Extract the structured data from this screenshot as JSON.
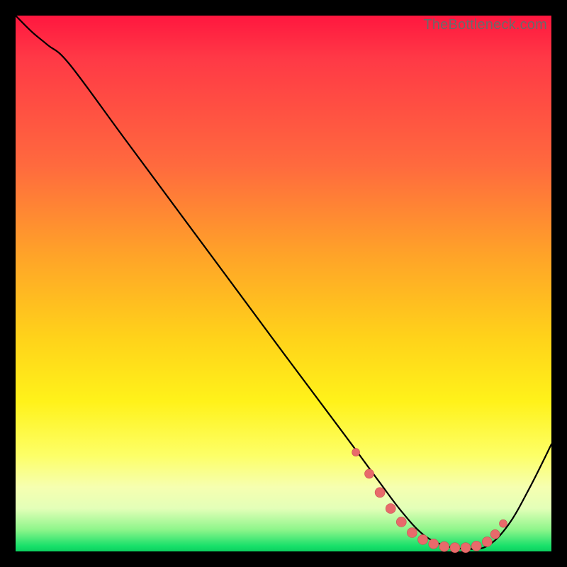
{
  "watermark": "TheBottleneck.com",
  "colors": {
    "background": "#000000",
    "curve_stroke": "#000000",
    "marker_fill": "#e86a6b",
    "marker_stroke": "#c94f50"
  },
  "chart_data": {
    "type": "line",
    "title": "",
    "xlabel": "",
    "ylabel": "",
    "xlim": [
      0,
      100
    ],
    "ylim": [
      0,
      100
    ],
    "grid": false,
    "legend": false,
    "description": "Black curve over red→green vertical gradient. Curve starts top-left (≈100), dips slightly, then falls roughly linearly to a flat valley near y≈0 around x 70–88, then rises toward the right edge.",
    "series": [
      {
        "name": "curve",
        "x": [
          0,
          3,
          6,
          10,
          20,
          30,
          40,
          50,
          58,
          63,
          68,
          72,
          76,
          80,
          84,
          88,
          92,
          96,
          100
        ],
        "y": [
          100,
          97,
          94.5,
          91,
          77.5,
          64,
          50.5,
          37,
          26.3,
          19.6,
          12.8,
          7.5,
          3.2,
          1.1,
          0.5,
          1.0,
          5.0,
          12.0,
          20.0
        ]
      }
    ],
    "markers": {
      "name": "valley-dots",
      "x": [
        63.5,
        66,
        68,
        70,
        72,
        74,
        76,
        78,
        80,
        82,
        84,
        86,
        88,
        89.5,
        91
      ],
      "y": [
        18.5,
        14.5,
        11.0,
        8.0,
        5.5,
        3.5,
        2.2,
        1.4,
        0.9,
        0.7,
        0.7,
        1.0,
        1.8,
        3.2,
        5.2
      ],
      "size": [
        5.5,
        6.5,
        7,
        7,
        7,
        7,
        7,
        7,
        7,
        7,
        7,
        7,
        7,
        6.5,
        5.5
      ]
    }
  }
}
